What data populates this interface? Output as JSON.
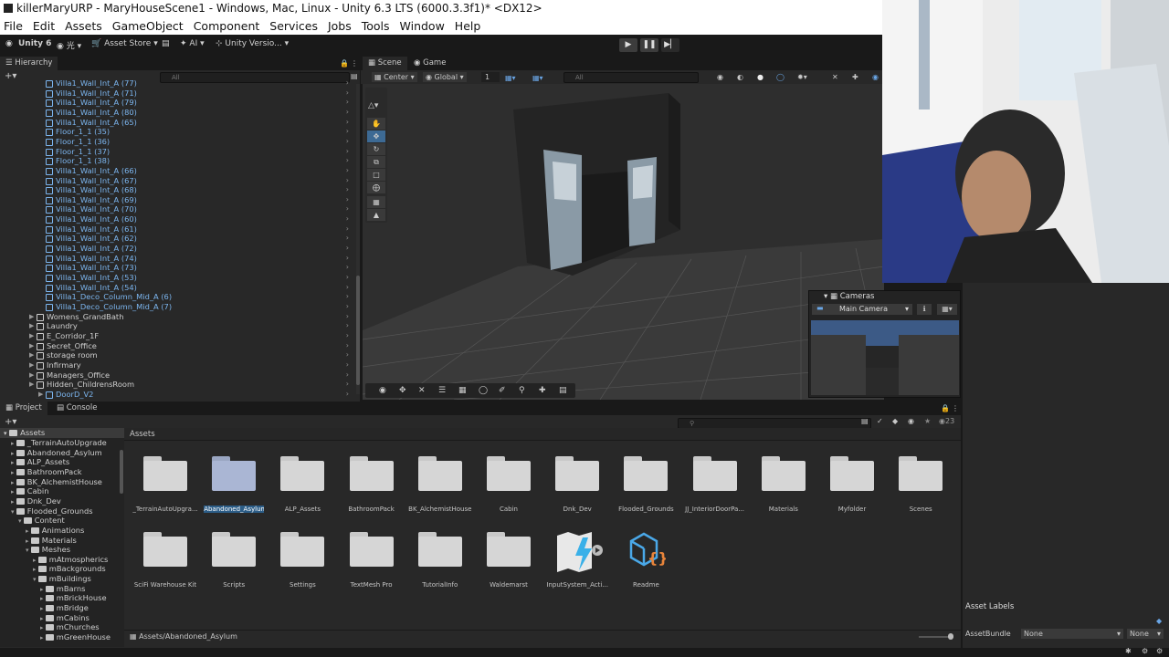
{
  "title": "killerMaryURP - MaryHouseScene1 - Windows, Mac, Linux - Unity 6.3 LTS (6000.3.3f1)* <DX12>",
  "menu": [
    "File",
    "Edit",
    "Assets",
    "GameObject",
    "Component",
    "Services",
    "Jobs",
    "Tools",
    "Window",
    "Help"
  ],
  "toolbar": {
    "unity_label": "Unity 6",
    "account_label": "光",
    "asset_store": "Asset Store",
    "ai_label": "AI",
    "version_control": "Unity Versio...",
    "play": "▶",
    "pause": "❚❚",
    "step": "▶▏"
  },
  "hierarchy": {
    "tab": "Hierarchy",
    "search_placeholder": "All",
    "items": [
      {
        "label": "Villa1_Wall_Int_A (77)",
        "color": "blue"
      },
      {
        "label": "Villa1_Wall_Int_A (71)",
        "color": "blue"
      },
      {
        "label": "Villa1_Wall_Int_A (79)",
        "color": "blue"
      },
      {
        "label": "Villa1_Wall_Int_A (80)",
        "color": "blue"
      },
      {
        "label": "Villa1_Wall_Int_A (65)",
        "color": "blue"
      },
      {
        "label": "Floor_1_1 (35)",
        "color": "blue"
      },
      {
        "label": "Floor_1_1 (36)",
        "color": "blue"
      },
      {
        "label": "Floor_1_1 (37)",
        "color": "blue"
      },
      {
        "label": "Floor_1_1 (38)",
        "color": "blue"
      },
      {
        "label": "Villa1_Wall_Int_A (66)",
        "color": "blue"
      },
      {
        "label": "Villa1_Wall_Int_A (67)",
        "color": "blue"
      },
      {
        "label": "Villa1_Wall_Int_A (68)",
        "color": "blue"
      },
      {
        "label": "Villa1_Wall_Int_A (69)",
        "color": "blue"
      },
      {
        "label": "Villa1_Wall_Int_A (70)",
        "color": "blue"
      },
      {
        "label": "Villa1_Wall_Int_A (60)",
        "color": "blue"
      },
      {
        "label": "Villa1_Wall_Int_A (61)",
        "color": "blue"
      },
      {
        "label": "Villa1_Wall_Int_A (62)",
        "color": "blue"
      },
      {
        "label": "Villa1_Wall_Int_A (72)",
        "color": "blue"
      },
      {
        "label": "Villa1_Wall_Int_A (74)",
        "color": "blue"
      },
      {
        "label": "Villa1_Wall_Int_A (73)",
        "color": "blue"
      },
      {
        "label": "Villa1_Wall_Int_A (53)",
        "color": "blue"
      },
      {
        "label": "Villa1_Wall_Int_A (54)",
        "color": "blue"
      },
      {
        "label": "Villa1_Deco_Column_Mid_A (6)",
        "color": "blue"
      },
      {
        "label": "Villa1_Deco_Column_Mid_A (7)",
        "color": "blue"
      },
      {
        "label": "Womens_GrandBath",
        "color": "white"
      },
      {
        "label": "Laundry",
        "color": "white"
      },
      {
        "label": "E_Corridor_1F",
        "color": "white"
      },
      {
        "label": "Secret_Office",
        "color": "white"
      },
      {
        "label": "storage room",
        "color": "white"
      },
      {
        "label": "Infirmary",
        "color": "white"
      },
      {
        "label": "Managers_Office",
        "color": "white"
      },
      {
        "label": "Hidden_ChildrensRoom",
        "color": "white"
      },
      {
        "label": "DoorD_V2",
        "color": "blue"
      }
    ]
  },
  "scene": {
    "tabs": [
      "Scene",
      "Game"
    ],
    "pivot": "Center",
    "space": "Global",
    "snap_value": "1",
    "search_placeholder": "All"
  },
  "cameras": {
    "title": "Cameras",
    "selected": "Main Camera"
  },
  "project": {
    "tabs": [
      "Project",
      "Console"
    ],
    "breadcrumb": "Assets",
    "count": "23",
    "path": "Assets/Abandoned_Asylum",
    "tree_root": "Assets",
    "tree": [
      {
        "label": "_TerrainAutoUpgrade",
        "depth": 1
      },
      {
        "label": "Abandoned_Asylum",
        "depth": 1
      },
      {
        "label": "ALP_Assets",
        "depth": 1
      },
      {
        "label": "BathroomPack",
        "depth": 1
      },
      {
        "label": "BK_AlchemistHouse",
        "depth": 1
      },
      {
        "label": "Cabin",
        "depth": 1
      },
      {
        "label": "Dnk_Dev",
        "depth": 1
      },
      {
        "label": "Flooded_Grounds",
        "depth": 1
      },
      {
        "label": "Content",
        "depth": 2
      },
      {
        "label": "Animations",
        "depth": 3
      },
      {
        "label": "Materials",
        "depth": 3
      },
      {
        "label": "Meshes",
        "depth": 3
      },
      {
        "label": "mAtmospherics",
        "depth": 4
      },
      {
        "label": "mBackgrounds",
        "depth": 4
      },
      {
        "label": "mBuildings",
        "depth": 4
      },
      {
        "label": "mBarns",
        "depth": 5
      },
      {
        "label": "mBrickHouse",
        "depth": 5
      },
      {
        "label": "mBridge",
        "depth": 5
      },
      {
        "label": "mCabins",
        "depth": 5
      },
      {
        "label": "mChurches",
        "depth": 5
      },
      {
        "label": "mGreenHouse",
        "depth": 5
      }
    ],
    "grid_row1": [
      "_TerrainAutoUpgra...",
      "Abandoned_Asylum",
      "ALP_Assets",
      "BathroomPack",
      "BK_AlchemistHouse",
      "Cabin",
      "Dnk_Dev",
      "Flooded_Grounds",
      "JJ_InteriorDoorPa...",
      "Materials",
      "Myfolder",
      "Scenes"
    ],
    "grid_row2": [
      "SciFi Warehouse Kit",
      "Scripts",
      "Settings",
      "TextMesh Pro",
      "TutorialInfo",
      "Waldemarst",
      "InputSystem_Acti...",
      "Readme"
    ]
  },
  "inspector": {
    "asset_labels": "Asset Labels",
    "asset_bundle": "AssetBundle",
    "bundle_value": "None",
    "variant_value": "None"
  },
  "colors": {
    "accent_blue": "#7cb6f0",
    "selection": "#2c5d87",
    "panel": "#282828"
  }
}
